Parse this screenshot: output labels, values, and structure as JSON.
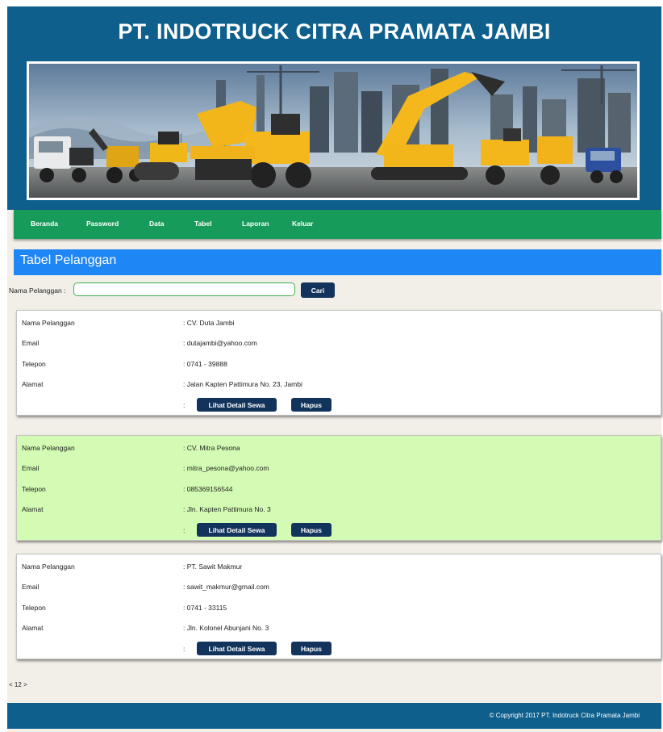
{
  "header": {
    "title": "PT. INDOTRUCK CITRA PRAMATA JAMBI"
  },
  "nav": {
    "items": [
      "Beranda",
      "Password",
      "Data",
      "Tabel",
      "Laporan",
      "Keluar"
    ]
  },
  "section": {
    "title": "Tabel Pelanggan"
  },
  "search": {
    "label": "Nama Pelanggan :",
    "value": "",
    "button": "Cari"
  },
  "labels": {
    "nama": "Nama Pelanggan",
    "email": "Email",
    "telepon": "Telepon",
    "alamat": "Alamat"
  },
  "buttons": {
    "detail": "Lihat Detail Sewa",
    "hapus": "Hapus"
  },
  "customers": [
    {
      "nama": ": CV. Duta Jambi",
      "email": ": dutajambi@yahoo.com",
      "telepon": ": 0741 - 39888",
      "alamat": ": Jalan Kapten Pattimura No. 23, Jambi",
      "bg": "#ffffff"
    },
    {
      "nama": ": CV. Mitra Pesona",
      "email": ": mitra_pesona@yahoo.com",
      "telepon": ": 085369156544",
      "alamat": ": Jln. Kapten Pattimura No. 3",
      "bg": "#d3fbb3"
    },
    {
      "nama": ": PT. Sawit Makmur",
      "email": ": sawit_makmur@gmail.com",
      "telepon": ": 0741 - 33115",
      "alamat": ": Jln. Kolonel Abunjani No. 3",
      "bg": "#ffffff"
    }
  ],
  "pagination": {
    "prev": "<",
    "pages": [
      "1",
      "2"
    ],
    "next": ">"
  },
  "footer": {
    "copyright": "© Copyright 2017 PT. Indotruck Citra Pramata Jambi"
  },
  "colors": {
    "header": "#0e5f8c",
    "nav": "#179b5a",
    "section": "#1f86f5",
    "button": "#12345c",
    "page": "#f2efe8",
    "highlight": "#d3fbb3"
  }
}
